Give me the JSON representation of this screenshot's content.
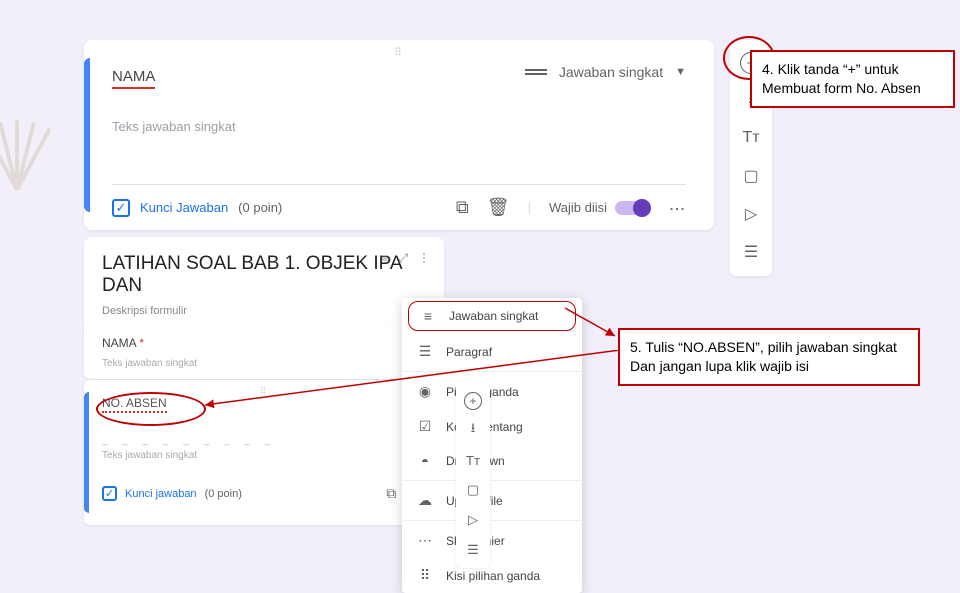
{
  "top_question": {
    "title": "NAMA",
    "type_label": "Jawaban singkat",
    "hint": "Teks jawaban singkat",
    "key_label": "Kunci Jawaban",
    "points": "(0 poin)",
    "required_label": "Wajib diisi"
  },
  "form_header": {
    "title": "LATIHAN SOAL BAB 1. OBJEK IPA DAN",
    "desc": "Deskripsi formulir"
  },
  "nama_card": {
    "label": "NAMA",
    "asterisk": "*",
    "sub": "Teks jawaban singkat"
  },
  "absen_card": {
    "title": "NO. ABSEN",
    "hint": "Teks jawaban singkat",
    "key": "Kunci jawaban",
    "points": "(0 poin)"
  },
  "dropdown": {
    "short": "Jawaban singkat",
    "paragraph": "Paragraf",
    "multiple": "Pilihan ganda",
    "checkbox": "Kotak centang",
    "dropdown": "Drop-down",
    "upload": "Upload file",
    "scale": "Skala linier",
    "grid": "Kisi pilihan ganda"
  },
  "annotations": {
    "a4_l1": "4. Klik tanda “+” untuk",
    "a4_l2": "Membuat form No. Absen",
    "a5_l1": "5. Tulis “NO.ABSEN”, pilih jawaban singkat",
    "a5_l2": "Dan jangan lupa klik wajib isi"
  }
}
